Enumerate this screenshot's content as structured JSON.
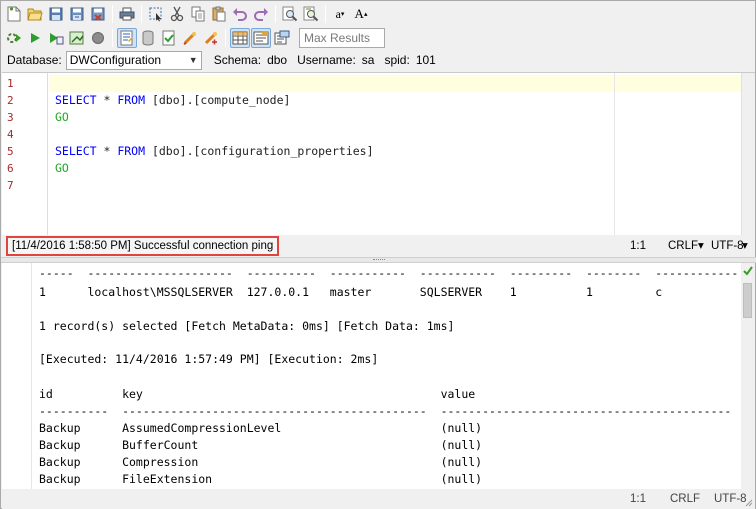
{
  "toolbar1": {
    "buttons": [
      "new-file-icon",
      "open-file-icon",
      "save-icon",
      "save-as-icon",
      "close-file-icon",
      "print-icon",
      "select-all-icon",
      "cut-icon",
      "copy-icon",
      "paste-icon",
      "undo-icon",
      "redo-icon",
      "find-icon",
      "find-replace-icon",
      "lowercase-icon",
      "uppercase-icon"
    ],
    "lowercase_label": "a",
    "uppercase_label": "A"
  },
  "toolbar2": {
    "buttons": [
      "execute-icon",
      "run-icon",
      "explain-icon",
      "export-icon",
      "stop-icon",
      "format-icon",
      "transaction-icon",
      "commit-icon",
      "rollback-icon",
      "auto-commit-icon",
      "results-grid-icon",
      "results-text-icon",
      "history-icon"
    ],
    "max_results_placeholder": "Max Results"
  },
  "connection": {
    "database_label": "Database:",
    "database_value": "DWConfiguration",
    "schema_label": "Schema:",
    "schema_value": "dbo",
    "username_label": "Username:",
    "username_value": "sa",
    "spid_label": "spid:",
    "spid_value": "101"
  },
  "editor": {
    "line_numbers": [
      "1",
      "2",
      "3",
      "4",
      "5",
      "6",
      "7"
    ],
    "lines": [
      {
        "select": "",
        "rest": ""
      },
      {
        "select": "SELECT",
        "star": " * ",
        "from": "FROM",
        "rest": " [dbo].[compute_node]"
      },
      {
        "go": "GO"
      },
      {
        "select": "",
        "rest": ""
      },
      {
        "select": "SELECT",
        "star": " * ",
        "from": "FROM",
        "rest": " [dbo].[configuration_properties]"
      },
      {
        "go": "GO"
      },
      {
        "select": "",
        "rest": ""
      }
    ]
  },
  "status": {
    "message": "[11/4/2016 1:58:50 PM] Successful connection ping",
    "position": "1:1",
    "line_ending": "CRLF",
    "encoding": "UTF-8"
  },
  "results": {
    "lines": [
      "-----  ---------------------  ----------  -----------  -----------  ---------  --------  ------------",
      "1      localhost\\MSSQLSERVER  127.0.0.1   master       SQLSERVER    1          1         c",
      "",
      "1 record(s) selected [Fetch MetaData: 0ms] [Fetch Data: 1ms]",
      "",
      "[Executed: 11/4/2016 1:57:49 PM] [Execution: 2ms]",
      "",
      "id          key                                           value",
      "----------  --------------------------------------------  ------------------------------------------",
      "Backup      AssumedCompressionLevel                       (null)",
      "Backup      BufferCount                                   (null)",
      "Backup      Compression                                   (null)",
      "Backup      FileExtension                                 (null)"
    ]
  },
  "status2": {
    "position": "1:1",
    "line_ending": "CRLF",
    "encoding": "UTF-8"
  }
}
